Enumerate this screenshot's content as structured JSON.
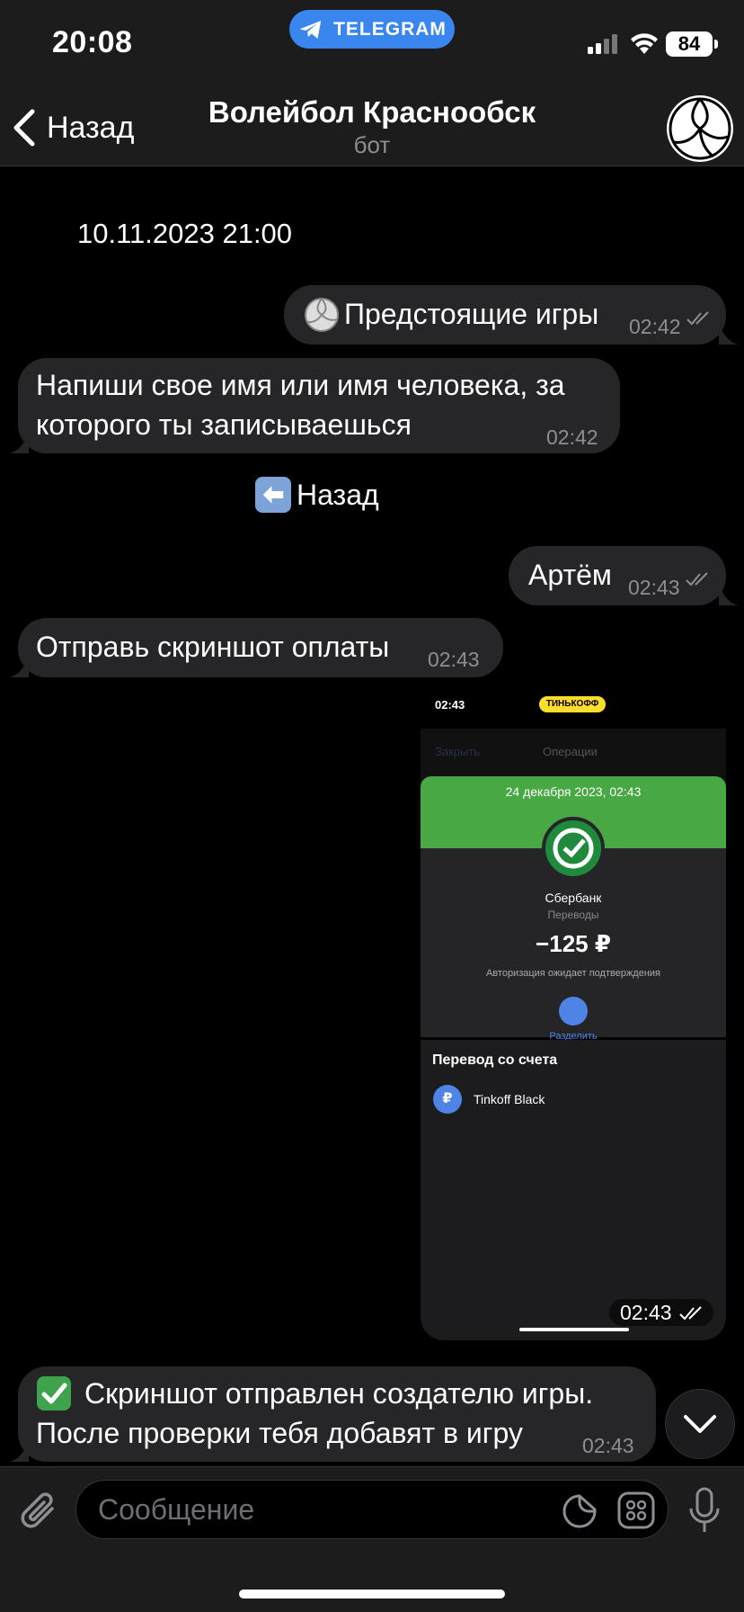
{
  "status_bar": {
    "time": "20:08",
    "app_pill": "TELEGRAM",
    "battery": "84"
  },
  "header": {
    "back_label": "Назад",
    "title": "Волейбол Краснообск",
    "subtitle": "бот"
  },
  "chat": {
    "date_text": "10.11.2023 21:00",
    "messages": [
      {
        "direction": "out",
        "emoji": "volleyball",
        "text": "Предстоящие игры",
        "time": "02:42",
        "read": true
      },
      {
        "direction": "in",
        "text_line1": "Напиши свое имя или имя человека, за",
        "text_line2": "которого ты записываешься",
        "time": "02:42"
      },
      {
        "direction": "out",
        "text": "Артём",
        "time": "02:43",
        "read": true
      },
      {
        "direction": "in",
        "text": "Отправь скриншот оплаты",
        "time": "02:43"
      },
      {
        "direction": "in",
        "emoji": "check-mark-button",
        "text_line1": "Скриншот отправлен создателю игры.",
        "text_line2": "После проверки тебя добавят в игру",
        "time": "02:43"
      }
    ],
    "back_button": {
      "emoji": "left-arrow",
      "label": "Назад"
    },
    "screenshot": {
      "time": "02:43",
      "phone_time": "02:43",
      "brand": "ТИНЬКОФФ",
      "close": "Закрыть",
      "operations": "Операции",
      "date": "24 декабря 2023, 02:43",
      "bank": "Сбербанк",
      "category": "Переводы",
      "amount": "−125 ₽",
      "auth_note": "Авторизация ожидает подтверждения",
      "split": "Разделить",
      "transfer_from": "Перевод со счета",
      "account": "Tinkoff Black"
    }
  },
  "input": {
    "placeholder": "Сообщение"
  },
  "colors": {
    "accent": "#3a86ef",
    "bubble": "#262628",
    "success_green": "#47a844"
  }
}
